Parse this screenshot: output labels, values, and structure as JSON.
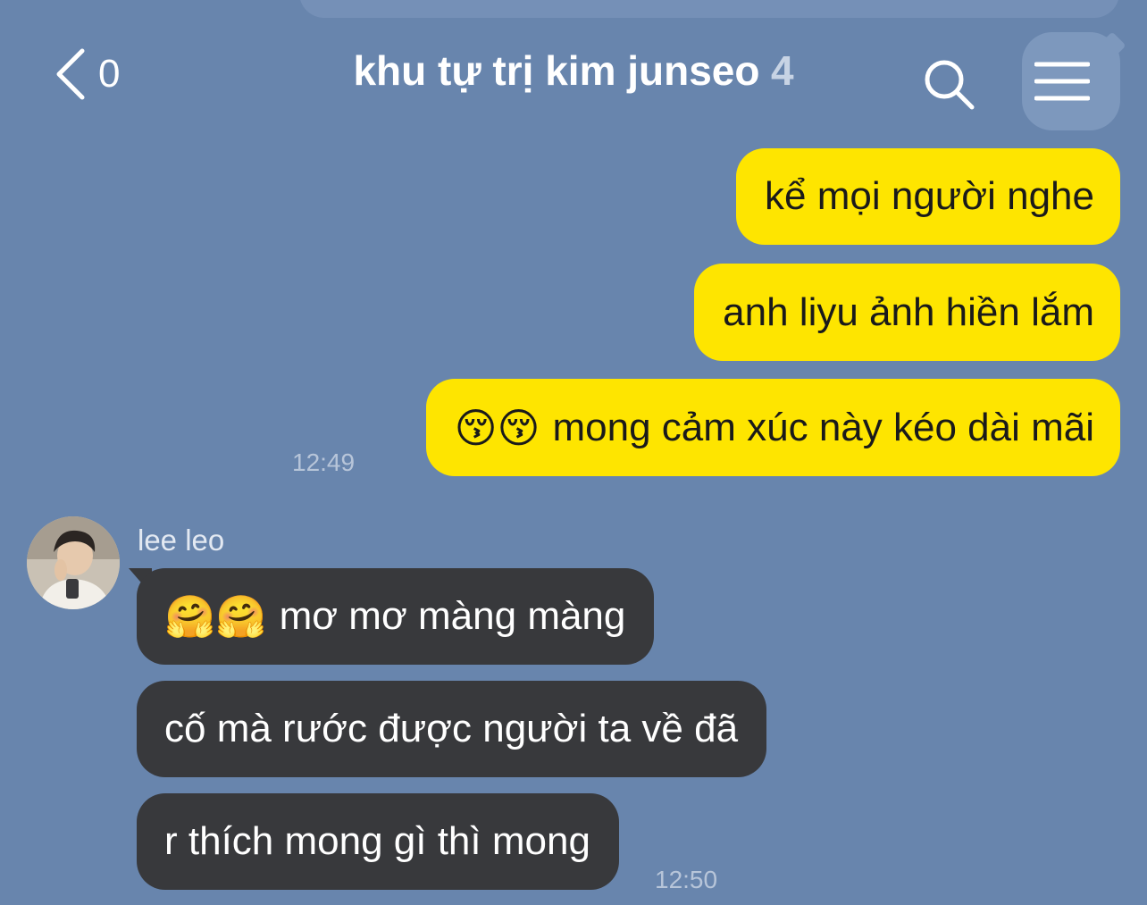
{
  "header": {
    "unread_count": "0",
    "title": "khu tự trị kim junseo",
    "member_count": "4",
    "back_icon": "chevron-left-icon",
    "search_icon": "search-icon",
    "menu_icon": "hamburger-menu-icon"
  },
  "messages": {
    "outgoing": [
      {
        "text": "kể mọi người nghe"
      },
      {
        "text": "anh liyu ảnh hiền lắm"
      },
      {
        "emoji": "😚😚",
        "text": "mong cảm xúc này kéo dài mãi"
      }
    ],
    "outgoing_time": "12:49",
    "sender": {
      "name": "lee leo",
      "avatar_icon": "user-avatar"
    },
    "incoming": [
      {
        "emoji": "🤗🤗",
        "text": "mơ mơ màng màng"
      },
      {
        "text": "cố mà rước được người ta về đã"
      },
      {
        "text": "r thích mong gì thì mong"
      }
    ],
    "incoming_time": "12:50"
  },
  "colors": {
    "background": "#6885ad",
    "outgoing_bubble": "#fee500",
    "incoming_bubble": "#38393c"
  }
}
